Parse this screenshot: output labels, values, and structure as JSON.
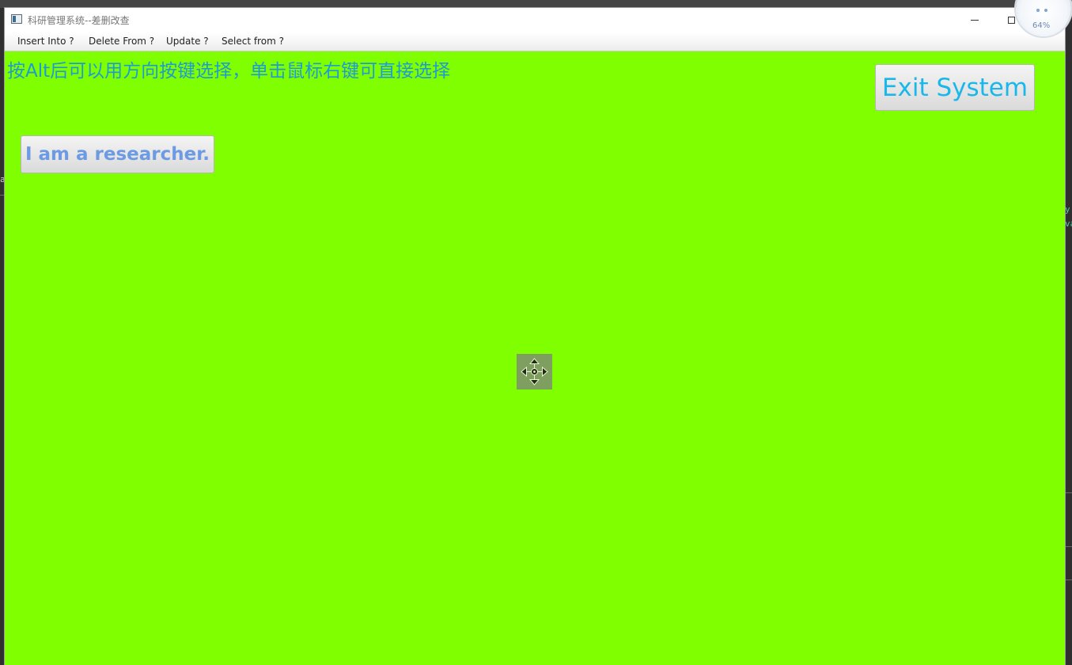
{
  "window": {
    "title": "科研管理系统--差删改查",
    "controls": {
      "minimize_icon": "minimize-icon",
      "maximize_icon": "maximize-icon",
      "close_icon": "close-icon"
    }
  },
  "menubar": {
    "items": [
      {
        "label": "Insert Into ?"
      },
      {
        "label": "Delete From ?"
      },
      {
        "label": "Update ?"
      },
      {
        "label": "Select from ?"
      }
    ]
  },
  "content": {
    "hint": "按Alt后可以用方向按键选择，单击鼠标右键可直接选择",
    "exit_button": "Exit System",
    "researcher_button": "I am a researcher."
  },
  "overlay": {
    "percent": "64%"
  },
  "background_fragments": {
    "left_a": "a",
    "right_y": "y",
    "right_va": "va"
  },
  "colors": {
    "window_background": "#7fff00",
    "hint_text": "#1f9bd3",
    "exit_text": "#19b7ea",
    "researcher_text": "#6d9be3"
  }
}
